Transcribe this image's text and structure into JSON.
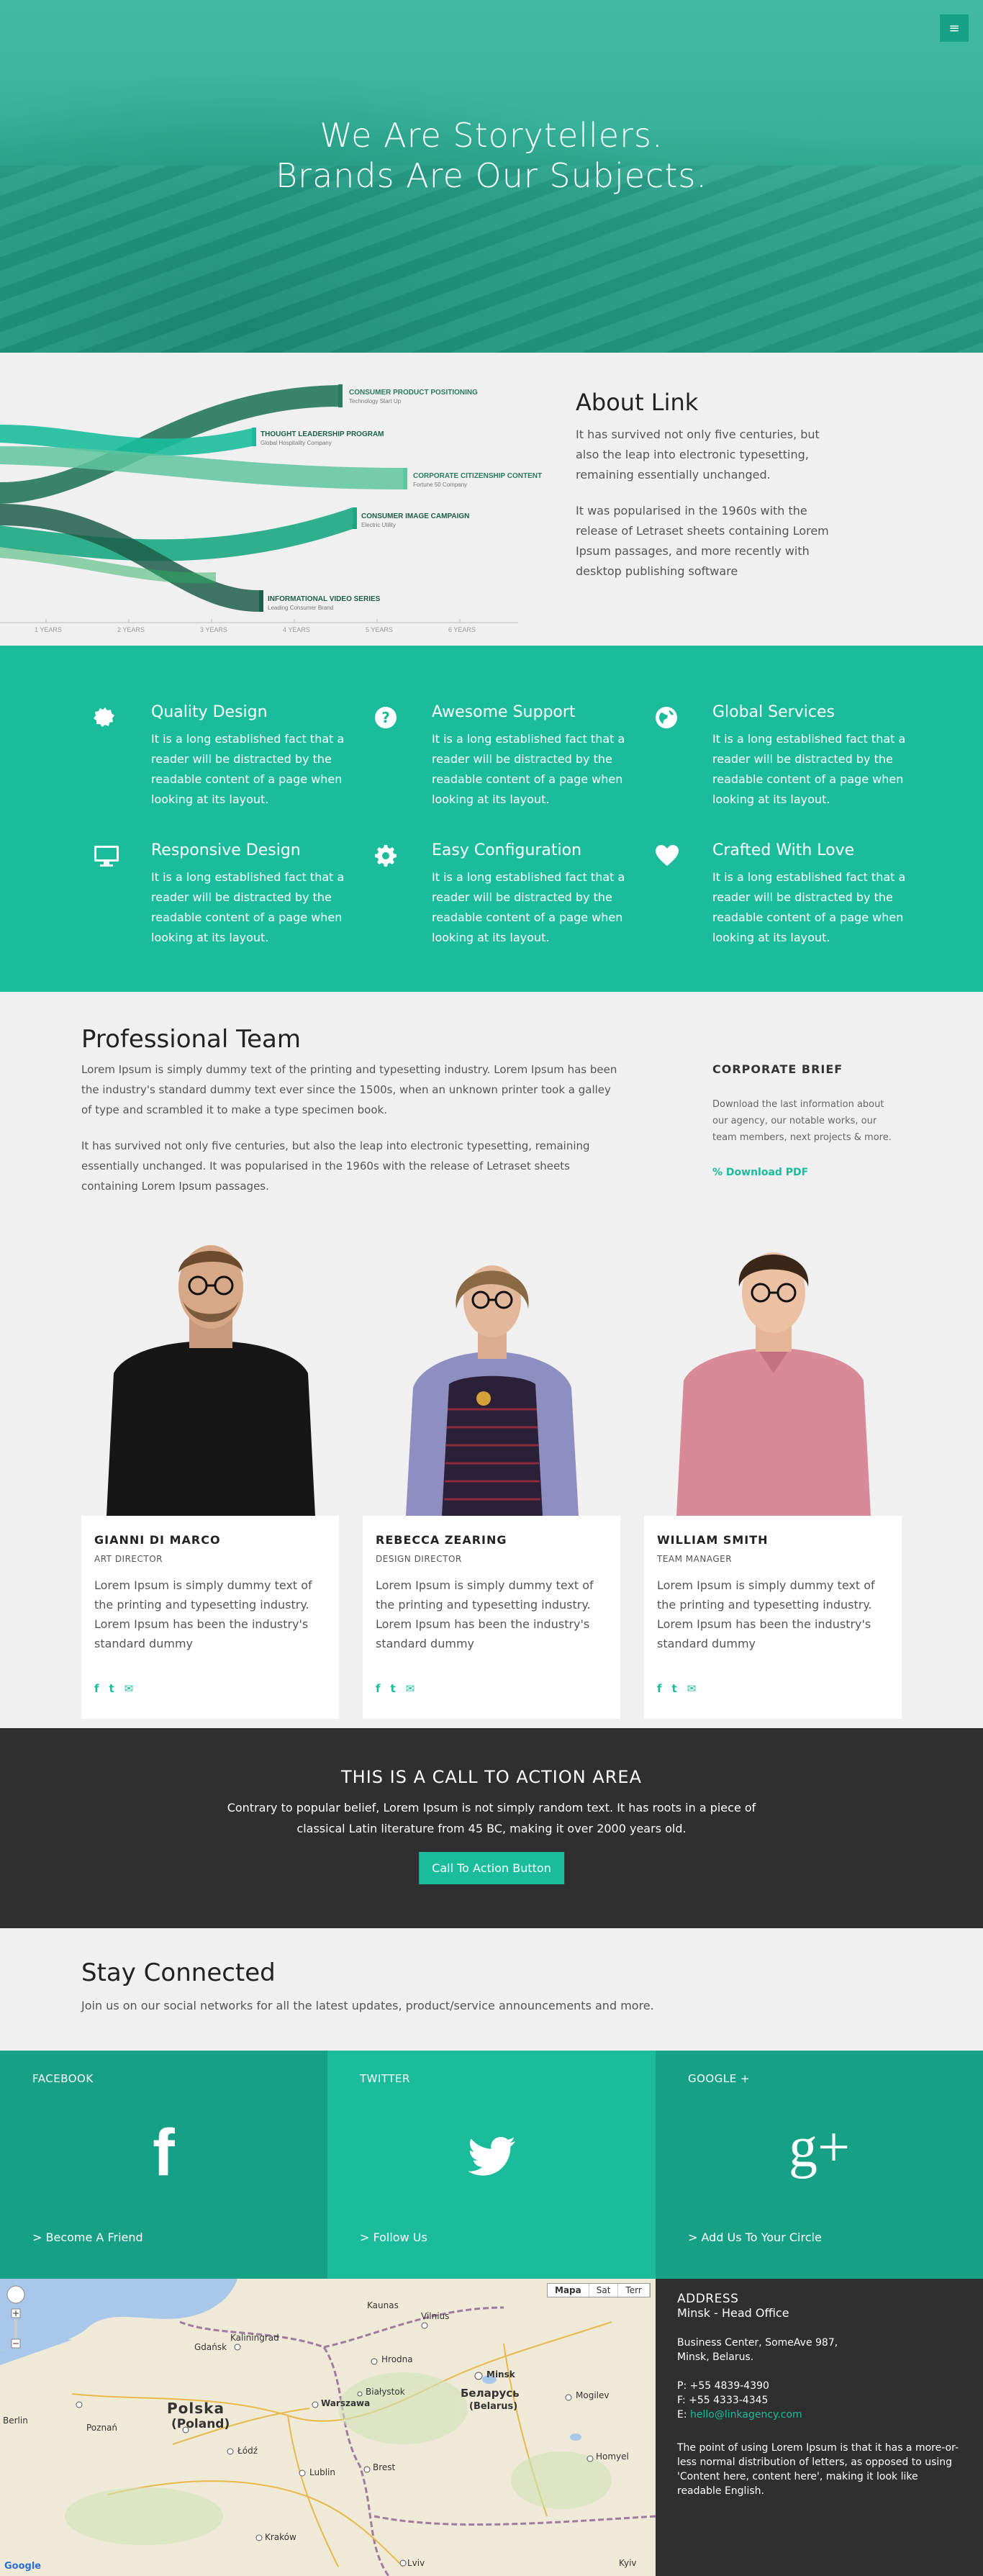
{
  "hero": {
    "menu_icon": "hamburger-icon",
    "headline_line1": "We Are Storytellers.",
    "headline_line2": "Brands Are Our Subjects."
  },
  "about": {
    "title": "About Link",
    "paragraph1": "It has survived not only five centuries, but also the leap into electronic typesetting, remaining essentially unchanged.",
    "paragraph2": "It was popularised in the 1960s with the release of Letraset sheets containing Lorem Ipsum passages, and more recently with desktop publishing software",
    "chart_data": {
      "type": "area",
      "streams": [
        {
          "name": "CONSUMER PRODUCT POSITIONING",
          "sub": "Technology Start Up"
        },
        {
          "name": "THOUGHT LEADERSHIP PROGRAM",
          "sub": "Global Hospitality Company"
        },
        {
          "name": "CORPORATE CITIZENSHIP CONTENT",
          "sub": "Fortune 50 Company"
        },
        {
          "name": "CONSUMER IMAGE CAMPAIGN",
          "sub": "Electric Utility"
        },
        {
          "name": "INFORMATIONAL VIDEO SERIES",
          "sub": "Leading Consumer Brand"
        }
      ],
      "x_ticks": [
        "1 YEARS",
        "2 YEARS",
        "3 YEARS",
        "4 YEARS",
        "5 YEARS",
        "6 YEARS"
      ]
    }
  },
  "features": [
    {
      "icon": "gear-badge-icon",
      "title": "Quality Design",
      "text": "It is a long established fact that a reader will be distracted by the readable content of a page when looking at its layout."
    },
    {
      "icon": "question-circle-icon",
      "title": "Awesome Support",
      "text": "It is a long established fact that a reader will be distracted by the readable content of a page when looking at its layout."
    },
    {
      "icon": "globe-icon",
      "title": "Global Services",
      "text": "It is a long established fact that a reader will be distracted by the readable content of a page when looking at its layout."
    },
    {
      "icon": "monitor-icon",
      "title": "Responsive Design",
      "text": "It is a long established fact that a reader will be distracted by the readable content of a page when looking at its layout."
    },
    {
      "icon": "cog-icon",
      "title": "Easy Configuration",
      "text": "It is a long established fact that a reader will be distracted by the readable content of a page when looking at its layout."
    },
    {
      "icon": "heart-icon",
      "title": "Crafted With Love",
      "text": "It is a long established fact that a reader will be distracted by the readable content of a page when looking at its layout."
    }
  ],
  "team": {
    "title": "Professional Team",
    "intro1": "Lorem Ipsum is simply dummy text of the printing and typesetting industry. Lorem Ipsum has been the industry's standard dummy text ever since the 1500s, when an unknown printer took a galley of type and scrambled it to make a type specimen book.",
    "intro2": "It has survived not only five centuries, but also the leap into electronic typesetting, remaining essentially unchanged. It was popularised in the 1960s with the release of Letraset sheets containing Lorem Ipsum passages.",
    "brief": {
      "title": "CORPORATE BRIEF",
      "text": "Download the last information about our agency, our notable works, our team members, next projects & more.",
      "link": "% Download PDF"
    },
    "members": [
      {
        "name": "GIANNI DI MARCO",
        "role": "ART DIRECTOR",
        "bio": "Lorem Ipsum is simply dummy text of the printing and typesetting industry. Lorem Ipsum has been the industry's standard dummy",
        "shirt": "#161616",
        "hair": "#6b4a2e"
      },
      {
        "name": "REBECCA ZEARING",
        "role": "DESIGN DIRECTOR",
        "bio": "Lorem Ipsum is simply dummy text of the printing and typesetting industry. Lorem Ipsum has been the industry's standard dummy",
        "shirt": "#2a2138",
        "hair": "#8a6a45"
      },
      {
        "name": "WILLIAM SMITH",
        "role": "TEAM MANAGER",
        "bio": "Lorem Ipsum is simply dummy text of the printing and typesetting industry. Lorem Ipsum has been the industry's standard dummy",
        "shirt": "#d98a98",
        "hair": "#3b2718"
      }
    ],
    "social_glyphs": [
      "f",
      "t",
      "✉"
    ]
  },
  "cta": {
    "title": "THIS IS A CALL TO ACTION AREA",
    "text": "Contrary to popular belief, Lorem Ipsum is not simply random text. It has roots in a piece of classical Latin literature from 45 BC, making it over 2000 years old.",
    "button": "Call To Action Button"
  },
  "stay": {
    "title": "Stay Connected",
    "text": "Join us on our social networks for all the latest updates, product/service announcements and more."
  },
  "socials": [
    {
      "title": "FACEBOOK",
      "glyph": "f",
      "link": "> Become A Friend",
      "color": "#16a085",
      "icon": "facebook-icon"
    },
    {
      "title": "TWITTER",
      "glyph": "",
      "link": "> Follow Us",
      "color": "#1abc9c",
      "icon": "twitter-bird-icon"
    },
    {
      "title": "GOOGLE +",
      "glyph": "g+",
      "link": "> Add Us To Your Circle",
      "color": "#16a085",
      "icon": "google-plus-icon"
    }
  ],
  "map": {
    "types": [
      "Mapa",
      "Sat",
      "Terr"
    ],
    "labels": {
      "polska": "Polska",
      "poland": "(Poland)",
      "belarus": "Беларусь",
      "belarus_en": "(Belarus)",
      "kaliningrad": "Kaliningrad",
      "kaunas": "Kaunas",
      "vilnius": "Vilnius",
      "minsk": "Minsk",
      "warszawa": "Warszawa",
      "gdansk": "Gdańsk",
      "lodz": "Łódź",
      "lublin": "Lublin",
      "brest": "Brest",
      "grodno": "Hrodna",
      "mogilev": "Mogilev",
      "gomel": "Homyel",
      "poznan": "Poznań",
      "berlin": "Berlin",
      "bialystok": "Białystok",
      "krakow": "Kraków",
      "lviv": "Lviv",
      "kyiv": "Kyiv",
      "google": "Google"
    }
  },
  "address": {
    "title": "ADDRESS",
    "office": "Minsk - Head Office",
    "line1": "Business Center, SomeAve 987,",
    "line2": "Minsk, Belarus.",
    "phone1": "P: +55 4839-4390",
    "phone2": "F: +55 4333-4345",
    "email_prefix": "E: ",
    "email": "hello@linkagency.com",
    "note": "The point of using Lorem Ipsum is that it has a more-or-less normal distribution of letters, as opposed to using 'Content here, content here', making it look like readable English."
  }
}
